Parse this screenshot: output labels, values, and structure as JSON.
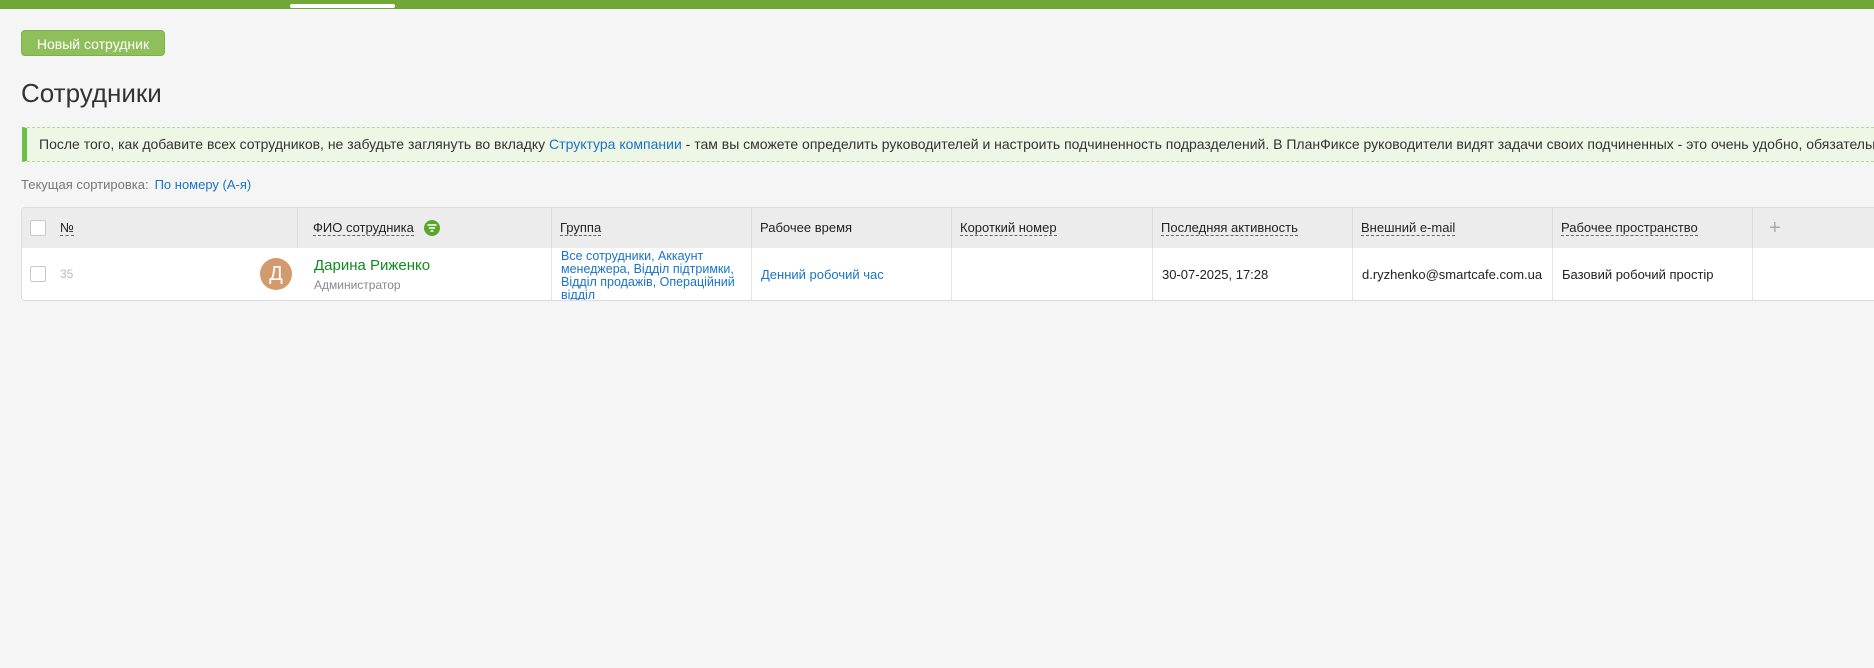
{
  "toolbar": {
    "new_employee_label": "Новый сотрудник"
  },
  "page": {
    "title": "Сотрудники"
  },
  "notice": {
    "text_before": "После того, как добавите всех сотрудников, не забудьте заглянуть во вкладку ",
    "link_text": "Структура компании",
    "text_after": " - там вы сможете определить руководителей и настроить подчиненность подразделений. В ПланФиксе руководители видят задачи своих подчиненных - это очень удобно, обязательно"
  },
  "sort": {
    "label": "Текущая сортировка:",
    "value": "По номеру (А-я)"
  },
  "table": {
    "columns": {
      "number": "№",
      "name": "ФИО сотрудника",
      "group": "Группа",
      "work_time": "Рабочее время",
      "short_number": "Короткий номер",
      "last_activity": "Последняя активность",
      "email": "Внешний e-mail",
      "workspace": "Рабочее пространство"
    },
    "add_column_icon": "plus-icon",
    "rows": [
      {
        "number": "35",
        "avatar_letter": "Д",
        "avatar_color": "#d39a6e",
        "name": "Дарина Риженко",
        "role": "Администратор",
        "groups": "Все сотрудники, Аккаунт менеджера, Відділ підтримки, Відділ продажів, Операційний відділ",
        "work_time": "Денний робочий час",
        "short_number": "",
        "last_activity": "30-07-2025, 17:28",
        "email": "d.ryzhenko@smartcafe.com.ua",
        "workspace": "Базовий робочий простір"
      }
    ]
  },
  "colors": {
    "accent": "#70a838",
    "link": "#1a73c9",
    "name": "#138a1f"
  }
}
